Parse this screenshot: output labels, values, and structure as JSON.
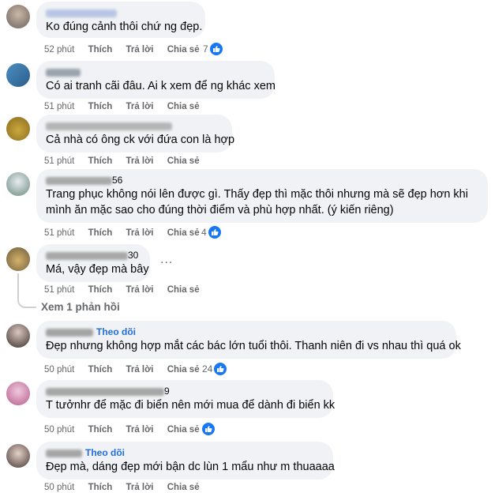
{
  "actions": {
    "like": "Thích",
    "reply": "Trả lời",
    "share": "Chia sẻ"
  },
  "comments": [
    {
      "name_suffix": "",
      "follow": "",
      "lines": [
        "Ko đúng cảnh thôi chứ ng đẹp."
      ],
      "time": "52 phút",
      "reactions": "7"
    },
    {
      "name_suffix": "",
      "follow": "",
      "lines": [
        "Có ai tranh cãi đâu. Ai k xem để ng khác xem"
      ],
      "time": "51 phút",
      "reactions": ""
    },
    {
      "name_suffix": "",
      "follow": "",
      "lines": [
        "Cả nhà có ông ck với đứa con là hợp"
      ],
      "time": "51 phút",
      "reactions": ""
    },
    {
      "name_suffix": "56",
      "follow": "",
      "lines": [
        "Trang phục không nói lên được gì. Thấy đẹp thì mặc thôi nhưng mà sẽ đẹp hơn khi",
        "mình ăn mặc sao cho đúng thời điểm và phù hợp nhất. (ý kiến riêng)"
      ],
      "time": "51 phút",
      "reactions": "4"
    },
    {
      "name_suffix": "30",
      "follow": "",
      "lines": [
        "Má, vậy đẹp mà bây"
      ],
      "time": "51 phút",
      "reactions": "",
      "more": "...",
      "replies": "Xem 1 phản hồi"
    },
    {
      "name_suffix": "",
      "follow": "Theo dõi",
      "lines": [
        "Đẹp nhưng không hợp mắt các bác lớn tuổi thôi. Thanh niên đi vs nhau thì quá ok"
      ],
      "time": "50 phút",
      "reactions": "24"
    },
    {
      "name_suffix": "9",
      "follow": "",
      "lines": [
        "T tưởnhr để mặc đi biển nên mới mua để dành đi biển kk"
      ],
      "time": "50 phút",
      "reactions": " "
    },
    {
      "name_suffix": "",
      "follow": "Theo dõi",
      "lines": [
        "Đẹp mà, dáng đẹp mới bận dc lùn 1 mẩu như m thuaaaa"
      ],
      "time": "50 phút",
      "reactions": ""
    }
  ],
  "colors": {
    "bubble": "#f0f2f5",
    "meta": "#65676b",
    "link": "#216fdb",
    "like": "#1877f2"
  },
  "icons": {
    "like": "thumbs-up-icon",
    "avatar": "avatar"
  }
}
